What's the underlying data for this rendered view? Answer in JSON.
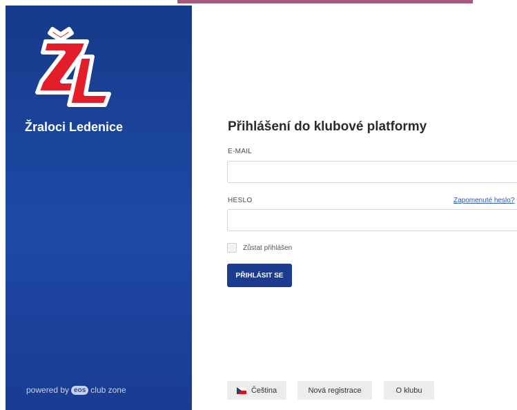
{
  "sidebar": {
    "club_name": "Žraloci Ledenice",
    "logo_text": "ŽL",
    "powered_prefix": "powered by",
    "powered_badge": "eos",
    "powered_suffix": "club zone",
    "colors": {
      "background": "#1e4aa6",
      "logo_red": "#e41d2a"
    }
  },
  "login": {
    "title": "Přihlášení do klubové platformy",
    "email_label": "E-MAIL",
    "email_value": "",
    "password_label": "HESLO",
    "password_value": "",
    "forgot_password": "Zapomenuté heslo?",
    "remember_label": "Zůstat přihlášen",
    "remember_checked": false,
    "submit_label": "PŘIHLÁSIT SE",
    "colors": {
      "primary": "#1c3d8f",
      "link": "#2a57b3"
    }
  },
  "footer": {
    "language_label": "Čeština",
    "language_flag": "czech-flag-icon",
    "register_label": "Nová registrace",
    "about_label": "O klubu"
  }
}
